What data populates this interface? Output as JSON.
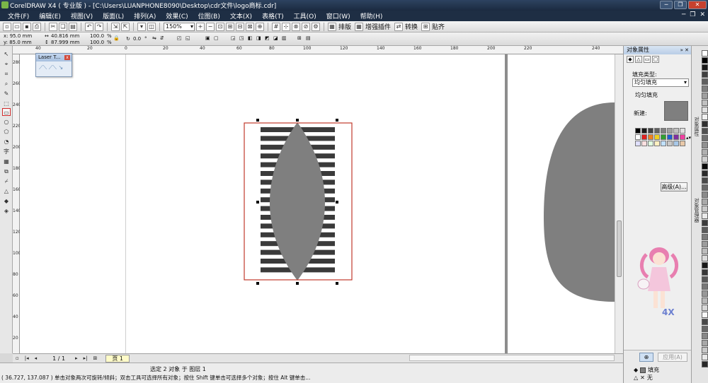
{
  "window": {
    "title": "CorelDRAW X4 ( 专业版 ) - [C:\\Users\\LUANPHONE8090\\Desktop\\cdr文件\\logo商标.cdr]",
    "minimize": "─",
    "restore": "❐",
    "close": "✕"
  },
  "menu": {
    "items": [
      "文件(F)",
      "编辑(E)",
      "视图(V)",
      "版面(L)",
      "排列(A)",
      "效果(C)",
      "位图(B)",
      "文本(X)",
      "表格(T)",
      "工具(O)",
      "窗口(W)",
      "帮助(H)"
    ],
    "controls": [
      "─",
      "❐",
      "✕"
    ]
  },
  "toolbar": {
    "zoom": "150%",
    "layout_label": "排版",
    "plugin_label": "增强插件",
    "convert_label": "转换",
    "align_label": "贴齐"
  },
  "propbar": {
    "x": "x: 95.0 mm",
    "y": "y: 85.0 mm",
    "width": "40.816 mm",
    "height": "87.999 mm",
    "scale_x": "100.0",
    "scale_y": "100.0",
    "pct_x": "%",
    "pct_y": "%",
    "rotation": "0.0",
    "degree": "°"
  },
  "ruler": {
    "h_labels": [
      "40",
      "20",
      "0",
      "20",
      "40",
      "60",
      "80",
      "100",
      "120",
      "140",
      "160",
      "180",
      "200",
      "220",
      "240"
    ],
    "v_labels": [
      "280",
      "260",
      "240",
      "220",
      "200",
      "180",
      "160",
      "140",
      "120",
      "100",
      "80",
      "60",
      "40",
      "20"
    ]
  },
  "laser_tool": {
    "title": "Laser T...",
    "close": "x",
    "tools": "⟋⟍ ⟋⟍ ↘"
  },
  "bottom": {
    "page_counter": "1 / 1",
    "page_tab": "页 1"
  },
  "status": {
    "selection": "选定 2 对象 于 图层 1",
    "hint": "( 36.727, 137.087 )  单击对象两次可旋转/倾斜；双击工具可选择所有对象；按住 Shift 键单击可选择多个对象；按住 Alt 键单击..."
  },
  "docker": {
    "title": "对象属性",
    "controls": "» ✕",
    "fill_type_label": "填充类型:",
    "fill_type_value": "均匀填充",
    "uniform_fill": "均匀填充",
    "new_label": "新建:",
    "advanced": "高级(A)...",
    "apply": "应用(A)",
    "lock": "⊕",
    "legend_fill": "填充",
    "legend_none": "无"
  },
  "colors": {
    "object_fill": "#7f7f7f",
    "stripe": "#3a3a3a",
    "selection_frame": "#c0392b",
    "palette": [
      "#000000",
      "#1a1a1a",
      "#404040",
      "#606060",
      "#808080",
      "#a0a0a0",
      "#c0c0c0",
      "#e0e0e0",
      "#ffffff",
      "#e02020",
      "#f08020",
      "#f0d020",
      "#30a030",
      "#2060d0",
      "#8030a0",
      "#f040a0",
      "#e0e0ff",
      "#ffe0e0",
      "#e0ffe0",
      "#fff0c0",
      "#c0e0ff",
      "#c8c8c8",
      "#a8c8e8",
      "#e8c8a8"
    ]
  }
}
